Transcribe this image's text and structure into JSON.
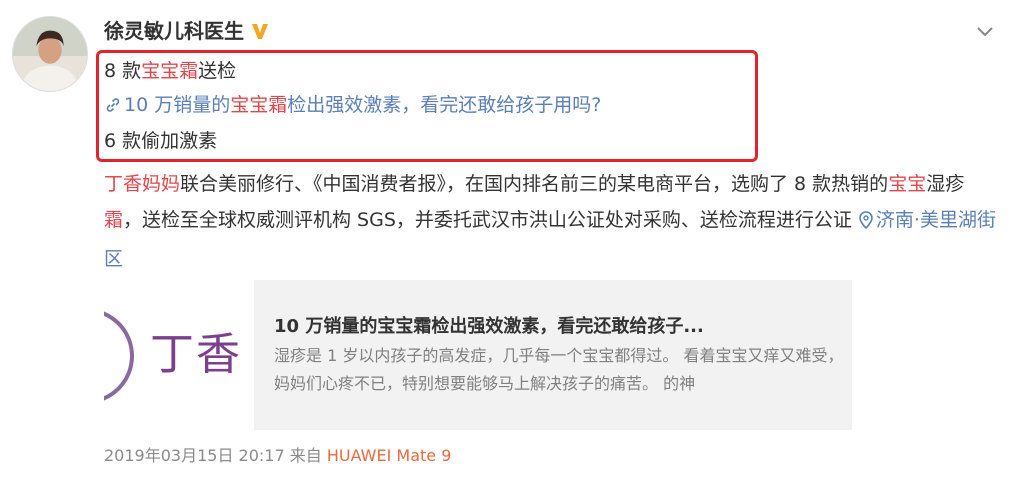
{
  "post": {
    "username": "徐灵敏儿科医生",
    "headline": {
      "line1_prefix": "8 款",
      "line1_highlight": "宝宝霜",
      "line1_suffix": "送检",
      "line2_prefix": "10 万销量的",
      "line2_highlight": "宝宝霜",
      "line2_suffix": "检出强效激素，看完还敢给孩子用吗?",
      "line3": "6 款偷加激素"
    },
    "body": {
      "part1_highlight": "丁香妈妈",
      "part2": "联合美丽修行、《中国消费者报》，在国内排名前三的某电商平台，选购了 8 款热销的",
      "part3_highlight": "宝宝",
      "part4": "湿疹",
      "part5_highlight": "霜",
      "part6": "，送检至全球权威测评机构 SGS，并委托武汉市洪山公证处对采购、送检流程进行公证",
      "location": "济南·美里湖街区"
    },
    "card": {
      "thumb_text": "丁香",
      "title": "10 万销量的宝宝霜检出强效激素，看完还敢给孩子...",
      "desc": "湿疹是 1 岁以内孩子的高发症，几乎每一个宝宝都得过。 看着宝宝又痒又难受，妈妈们心疼不已，特别想要能够马上解决孩子的痛苦。 的神"
    },
    "footer": {
      "timestamp": "2019年03月15日 20:17",
      "from_label": "来自",
      "device": "HUAWEI Mate 9"
    }
  },
  "icons": {
    "verified": "verified-v-badge-icon",
    "chevron": "chevron-down-icon",
    "link": "link-icon",
    "location": "location-pin-icon"
  },
  "colors": {
    "highlight_red": "#e0464b",
    "link_blue": "#5b7fb5",
    "box_border": "#e3222a",
    "verified_gold": "#f5a623",
    "device_orange": "#e86a3c"
  }
}
